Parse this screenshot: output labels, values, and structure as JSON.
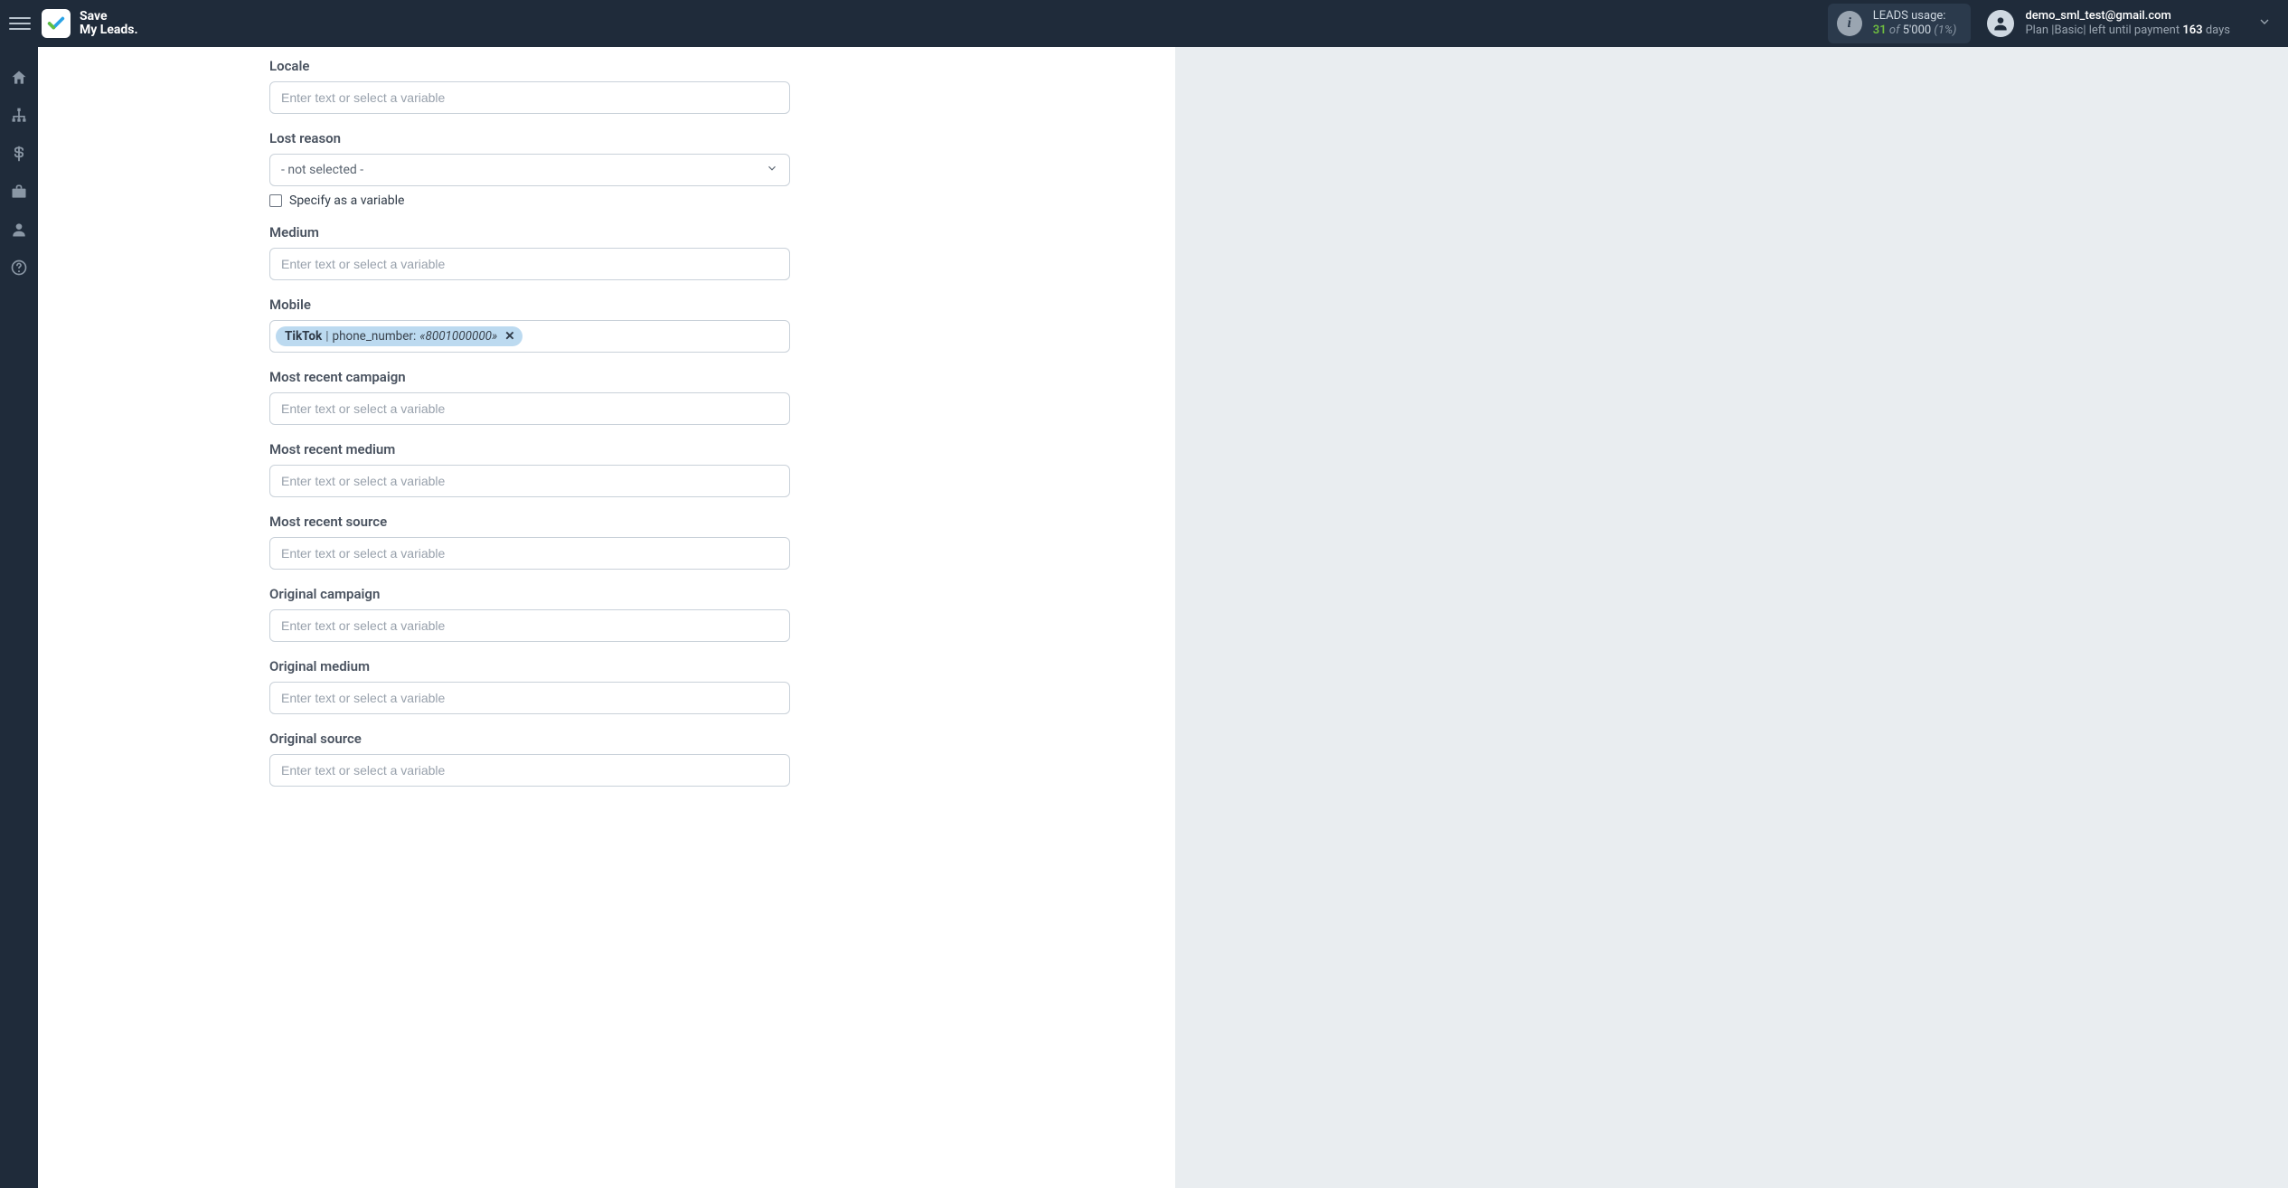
{
  "brand": {
    "line1": "Save",
    "line2": "My Leads."
  },
  "usage": {
    "title": "LEADS usage:",
    "used": "31",
    "of": "of",
    "total": "5'000",
    "pct": "(1%)"
  },
  "account": {
    "email": "demo_sml_test@gmail.com",
    "plan_prefix": "Plan |",
    "plan_name": "Basic",
    "plan_mid": "| left until payment ",
    "days": "163",
    "days_suffix": " days"
  },
  "placeholders": {
    "text": "Enter text or select a variable"
  },
  "select": {
    "not_selected": "- not selected -"
  },
  "checkbox": {
    "specify_variable": "Specify as a variable"
  },
  "fields": {
    "locale": {
      "label": "Locale"
    },
    "lost_reason": {
      "label": "Lost reason"
    },
    "medium": {
      "label": "Medium"
    },
    "mobile": {
      "label": "Mobile",
      "chip": {
        "source": "TikTok",
        "field": "phone_number:",
        "value": "«8001000000»"
      }
    },
    "most_recent_campaign": {
      "label": "Most recent campaign"
    },
    "most_recent_medium": {
      "label": "Most recent medium"
    },
    "most_recent_source": {
      "label": "Most recent source"
    },
    "original_campaign": {
      "label": "Original campaign"
    },
    "original_medium": {
      "label": "Original medium"
    },
    "original_source": {
      "label": "Original source"
    }
  }
}
